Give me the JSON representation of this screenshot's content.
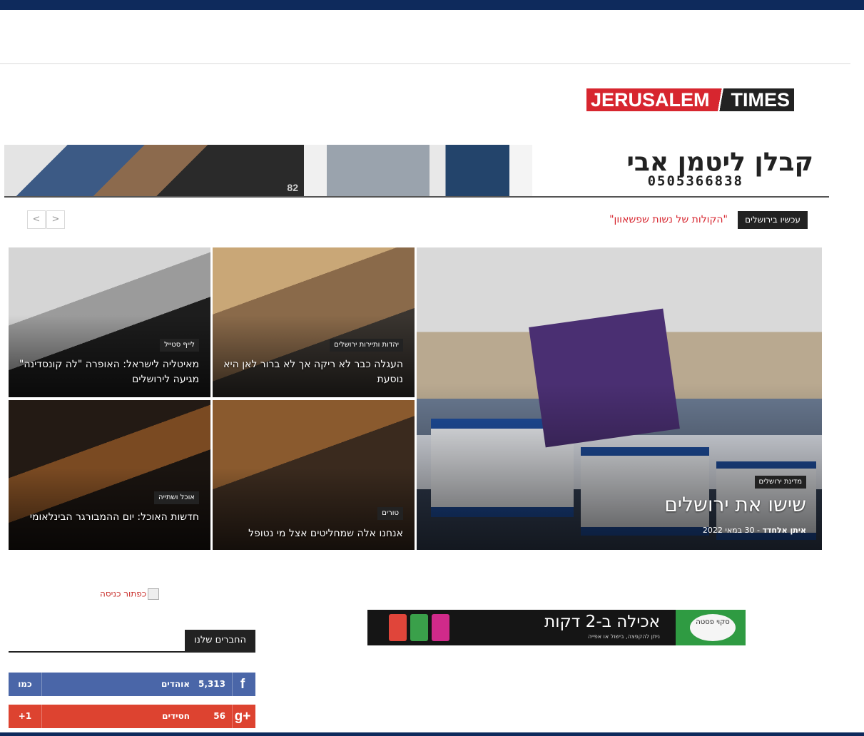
{
  "logo": {
    "part1": "JERUSALEM",
    "part2": "TIMES"
  },
  "header_ad": {
    "name": "קבלן ליטמן אבי",
    "phone": "0505366838",
    "photo_number": "82"
  },
  "ticker": {
    "label": "עכשיו בירושלים",
    "text": "\"הקולות של נשות שפשאוון\"",
    "prev": "<",
    "next": ">"
  },
  "grid": {
    "main": {
      "category": "מדינת ירושלים",
      "title": "שישו את ירושלים",
      "author": "איתן אלחדד",
      "date": "30 במאי 2022"
    },
    "b1": {
      "category": "יהדות ותיירות ירושלים",
      "title": "העגלה כבר לא ריקה אך לא ברור לאן היא נוסעת"
    },
    "b2": {
      "category": "לייף סטייל",
      "title": "מאיטליה לישראל: האופרה \"לה קונסדינה\" מגיעה לירושלים"
    },
    "b3": {
      "category": "טורים",
      "title": "אנחנו אלה שמחליטים אצל מי נטופל"
    },
    "b4": {
      "category": "אוכל ושתייה",
      "title": "חדשות האוכל: יום ההמבורגר הבינלאומי"
    }
  },
  "entry_button_alt": "כפתור כניסה",
  "food_ad": {
    "headline": "אכילה ב-2 דקות",
    "subline": "ניתן להקפצה, בישול או אפייה",
    "brand": "סקוי פסטה"
  },
  "friends": {
    "heading": "החברים שלנו",
    "facebook": {
      "icon": "f",
      "count": "5,313",
      "unit": "אוהדים",
      "action": "כמו"
    },
    "google": {
      "icon": "g+",
      "count": "56",
      "unit": "חסידים",
      "action": "+1"
    }
  },
  "colors": {
    "navy": "#0e2a5c",
    "red": "#d7262f",
    "facebook": "#4a66a8",
    "google": "#dd4330"
  }
}
